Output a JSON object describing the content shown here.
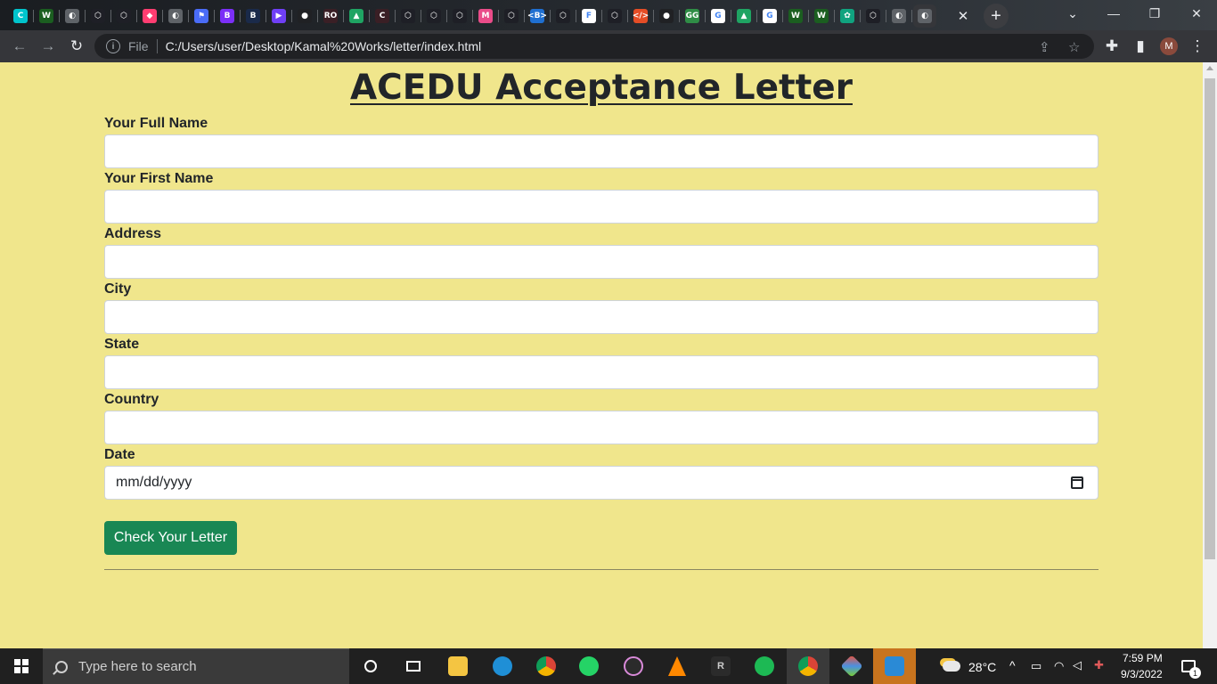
{
  "browser": {
    "tab_favicons": [
      {
        "name": "canva",
        "color": "#00c4cc",
        "glyph": "C"
      },
      {
        "name": "webflow",
        "color": "#1b5e20",
        "glyph": "W"
      },
      {
        "name": "globe",
        "color": "#5f6368",
        "glyph": "◐"
      },
      {
        "name": "codepen",
        "color": "#1e1f26",
        "glyph": "⬡"
      },
      {
        "name": "codepen",
        "color": "#1e1f26",
        "glyph": "⬡"
      },
      {
        "name": "cube",
        "color": "#ff3d71",
        "glyph": "◆"
      },
      {
        "name": "globe",
        "color": "#5f6368",
        "glyph": "◐"
      },
      {
        "name": "flag",
        "color": "#4a6cf7",
        "glyph": "⚑"
      },
      {
        "name": "bootstrap",
        "color": "#7b2ff7",
        "glyph": "B"
      },
      {
        "name": "brand-b",
        "color": "#1a2a4a",
        "glyph": "B"
      },
      {
        "name": "play",
        "color": "#6f3ff5",
        "glyph": "▶"
      },
      {
        "name": "github",
        "color": "#202124",
        "glyph": "●"
      },
      {
        "name": "ro",
        "color": "#3a1f25",
        "glyph": "RO"
      },
      {
        "name": "drive",
        "color": "#1fa463",
        "glyph": "▲"
      },
      {
        "name": "cc",
        "color": "#3a1f25",
        "glyph": "C"
      },
      {
        "name": "codepen",
        "color": "#1e1f26",
        "glyph": "⬡"
      },
      {
        "name": "codepen",
        "color": "#1e1f26",
        "glyph": "⬡"
      },
      {
        "name": "codepen",
        "color": "#1e1f26",
        "glyph": "⬡"
      },
      {
        "name": "mail",
        "color": "#ea4c89",
        "glyph": "M"
      },
      {
        "name": "codepen",
        "color": "#1e1f26",
        "glyph": "⬡"
      },
      {
        "name": "bootstrap-blue",
        "color": "#1f6fd1",
        "glyph": "<B>"
      },
      {
        "name": "codepen",
        "color": "#1e1f26",
        "glyph": "⬡"
      },
      {
        "name": "framer",
        "color": "#ffffff",
        "glyph": "F"
      },
      {
        "name": "codepen",
        "color": "#1e1f26",
        "glyph": "⬡"
      },
      {
        "name": "code",
        "color": "#e44d26",
        "glyph": "</>"
      },
      {
        "name": "github",
        "color": "#202124",
        "glyph": "●"
      },
      {
        "name": "geeks",
        "color": "#2f8d46",
        "glyph": "GG"
      },
      {
        "name": "google",
        "color": "#ffffff",
        "glyph": "G"
      },
      {
        "name": "drive",
        "color": "#1fa463",
        "glyph": "▲"
      },
      {
        "name": "google",
        "color": "#ffffff",
        "glyph": "G"
      },
      {
        "name": "webflow",
        "color": "#1b5e20",
        "glyph": "W"
      },
      {
        "name": "webflow",
        "color": "#1b5e20",
        "glyph": "W"
      },
      {
        "name": "openai",
        "color": "#10a37f",
        "glyph": "✿"
      },
      {
        "name": "codepen",
        "color": "#1e1f26",
        "glyph": "⬡"
      },
      {
        "name": "globe",
        "color": "#5f6368",
        "glyph": "◐"
      },
      {
        "name": "globe",
        "color": "#5f6368",
        "glyph": "◐"
      }
    ],
    "address_scheme": "File",
    "address_url": "C:/Users/user/Desktop/Kamal%20Works/letter/index.html",
    "profile_initial": "M",
    "accent_color": "#35363a"
  },
  "page": {
    "title": "ACEDU Acceptance Letter",
    "background": "#f0e68c",
    "fields": [
      {
        "label": "Your Full Name",
        "value": ""
      },
      {
        "label": "Your First Name",
        "value": ""
      },
      {
        "label": "Address",
        "value": ""
      },
      {
        "label": "City",
        "value": ""
      },
      {
        "label": "State",
        "value": ""
      },
      {
        "label": "Country",
        "value": ""
      }
    ],
    "date_field": {
      "label": "Date",
      "placeholder": "mm/dd/yyyy"
    },
    "submit_label": "Check Your Letter",
    "submit_color": "#198754"
  },
  "taskbar": {
    "search_placeholder": "Type here to search",
    "weather_temp": "28°C",
    "time": "7:59 PM",
    "date": "9/3/2022",
    "notification_count": "1",
    "apps": [
      "cortana",
      "task-view",
      "file-explorer",
      "edge",
      "chrome",
      "whatsapp",
      "groove",
      "vlc",
      "r-app",
      "spotify",
      "chrome-profile",
      "git",
      "vscode"
    ]
  }
}
